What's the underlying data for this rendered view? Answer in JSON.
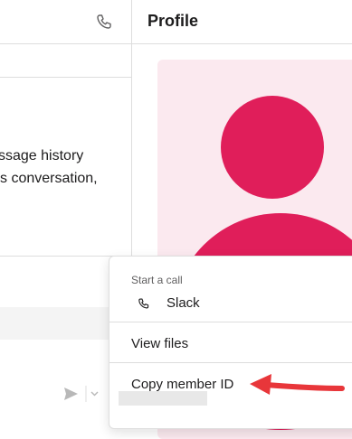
{
  "conversation": {
    "history_line1": "ssage history",
    "history_line2": "s conversation,"
  },
  "profile": {
    "title": "Profile",
    "avatar_color": "#e01e5a",
    "avatar_bg": "#fbe9ef"
  },
  "menu": {
    "section_label": "Start a call",
    "slack_label": "Slack",
    "view_files_label": "View files",
    "copy_member_id_label": "Copy member ID"
  },
  "annotation": {
    "arrow_color": "#e8363a"
  },
  "icons": {
    "header_call": "phone-icon",
    "slack_call": "phone-icon",
    "send": "send-icon",
    "dropdown": "chevron-down-icon"
  }
}
